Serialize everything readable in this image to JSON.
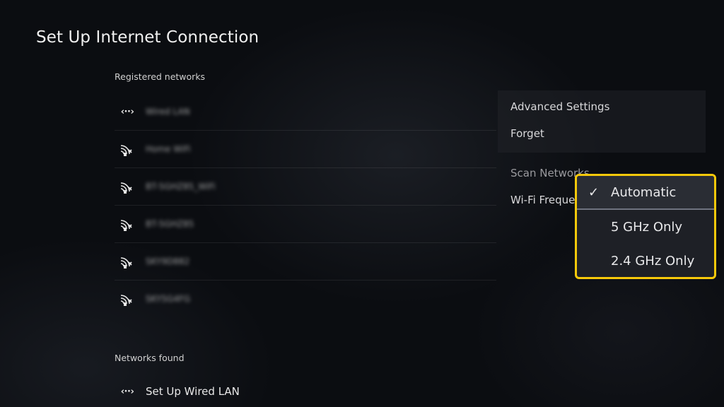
{
  "header": {
    "title": "Set Up Internet Connection"
  },
  "registered": {
    "label": "Registered networks",
    "items": [
      {
        "icon": "lan-icon",
        "name": "Wired LAN"
      },
      {
        "icon": "wifi-locked-icon",
        "name": "Home WiFi"
      },
      {
        "icon": "wifi-locked-icon",
        "name": "BT-5GHZ85_WiFi"
      },
      {
        "icon": "wifi-locked-icon",
        "name": "BT-5GHZ85"
      },
      {
        "icon": "wifi-locked-icon",
        "name": "SKY9D882"
      },
      {
        "icon": "wifi-locked-icon",
        "name": "SKY5G4FG"
      }
    ]
  },
  "found": {
    "label": "Networks found",
    "wired_label": "Set Up Wired LAN",
    "wired_icon": "lan-icon"
  },
  "options": {
    "advanced": "Advanced Settings",
    "forget": "Forget",
    "scan": "Scan Networks",
    "wifi_frequency": "Wi-Fi Freque"
  },
  "dropdown": {
    "items": [
      {
        "label": "Automatic",
        "selected": true
      },
      {
        "label": "5 GHz Only",
        "selected": false
      },
      {
        "label": "2.4 GHz Only",
        "selected": false
      }
    ],
    "check_icon": "checkmark-icon",
    "highlight_color": "#f7c90a"
  }
}
